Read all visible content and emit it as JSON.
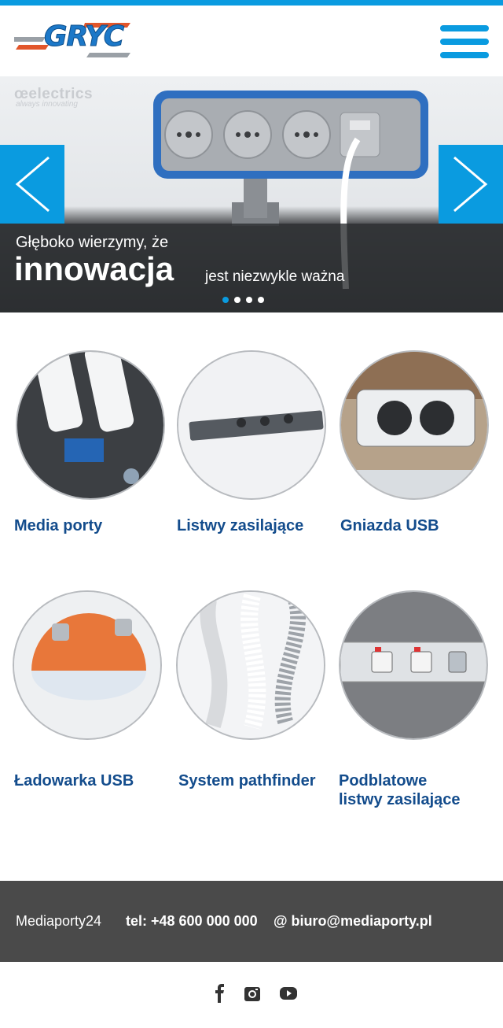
{
  "header": {
    "logo_text": "GRYC",
    "menu_icon": "hamburger-menu-icon"
  },
  "hero": {
    "brand": "œelectrics",
    "brand_tagline": "always innovating",
    "caption_line1": "Głęboko wierzymy, że",
    "caption_highlight": "innowacja",
    "caption_rest": "jest niezwykle ważna",
    "prev_icon": "chevron-left-icon",
    "next_icon": "chevron-right-icon",
    "slides_count": 4,
    "active_slide": 1
  },
  "products": [
    {
      "label": "Media porty",
      "image": "media-port-usb-icon"
    },
    {
      "label": "Listwy zasilające",
      "image": "power-strip-icon"
    },
    {
      "label": "Gniazda USB",
      "image": "usb-socket-icon"
    },
    {
      "label": "Ładowarka USB",
      "image": "usb-charger-ball-icon"
    },
    {
      "label": "System pathfinder",
      "image": "cable-spine-icon"
    },
    {
      "label": "Podblatowe listwy zasilające",
      "label_line1": "Podblatowe",
      "label_line2": "listwy zasilające",
      "image": "underdesk-power-strip-icon"
    }
  ],
  "footer": {
    "brand": "Mediaporty24",
    "phone": "tel: +48 600 000 000",
    "email": "@ biuro@mediaporty.pl"
  },
  "social": {
    "icons": [
      "facebook-icon",
      "instagram-icon",
      "youtube-icon"
    ]
  },
  "colors": {
    "accent": "#0a9be0",
    "link": "#134c8c",
    "footer_bg": "#4a4a4a"
  }
}
